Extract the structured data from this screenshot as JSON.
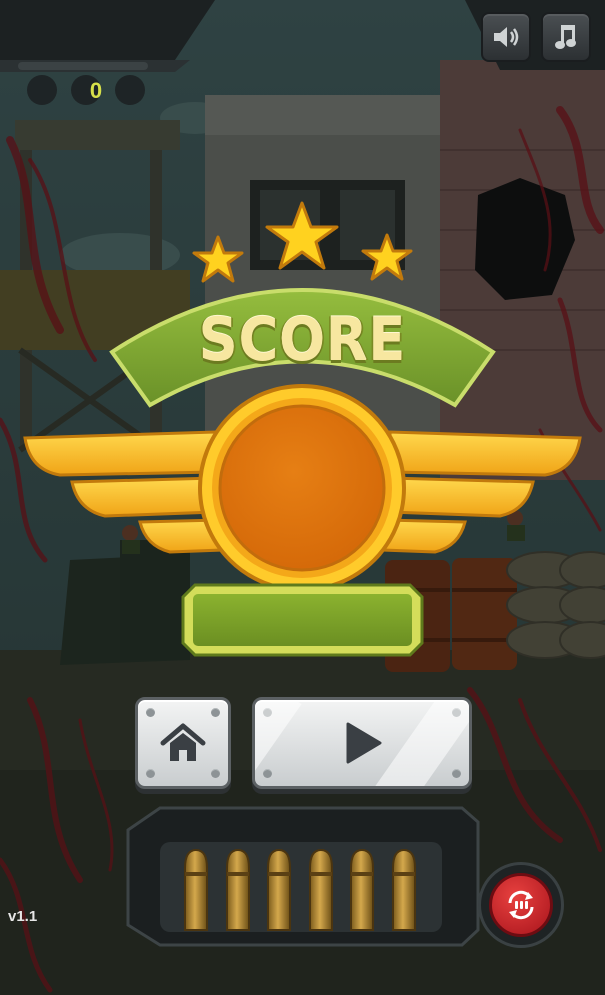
{
  "hud": {
    "sound_button": "speaker-icon",
    "music_button": "music-note-icon",
    "level_indicator": "0"
  },
  "score_panel": {
    "title": "SCORE",
    "stars": 3,
    "score_value": ""
  },
  "buttons": {
    "home": "home-icon",
    "play": "play-icon"
  },
  "ammo": {
    "bullets_remaining": 6,
    "reload_button": "reload-icon"
  },
  "version": "v1.1",
  "colors": {
    "gold": "#f5b51e",
    "army_green": "#7ea53a",
    "plate_gray": "#dfe2e3",
    "blood_red": "#8e1a23",
    "reload_red": "#c41d24"
  }
}
